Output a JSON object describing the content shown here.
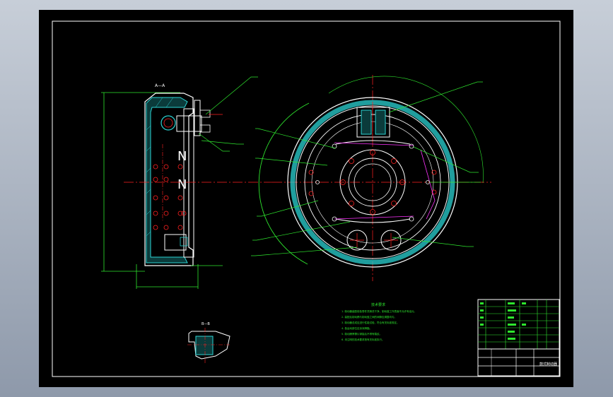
{
  "drawing": {
    "section_a_label": "A—A",
    "section_b_label": "B—B",
    "tech_title": "技术要求",
    "tech_notes": [
      "1. 制动器装配前各零件须清洗干净，制动鼓工作表面不允许有油污。",
      "2. 装配后制动蹄与制动鼓之间的间隙应调整均匀。",
      "3. 制动器总成应进行性能试验，符合有关标准规定。",
      "4. 各运动部位应涂润滑脂。",
      "5. 制动蹄摩擦片铆接后不得有裂纹。",
      "6. 未注明的技术要求按有关标准执行。"
    ],
    "title_block": {
      "name": "鼓式制动器"
    },
    "colors": {
      "outline": "#ffffff",
      "annotation": "#2ee62e",
      "centerline": "#ff2020",
      "hidden": "#ff33ff",
      "hatch": "#2bd3d3",
      "background": "#000000"
    }
  }
}
